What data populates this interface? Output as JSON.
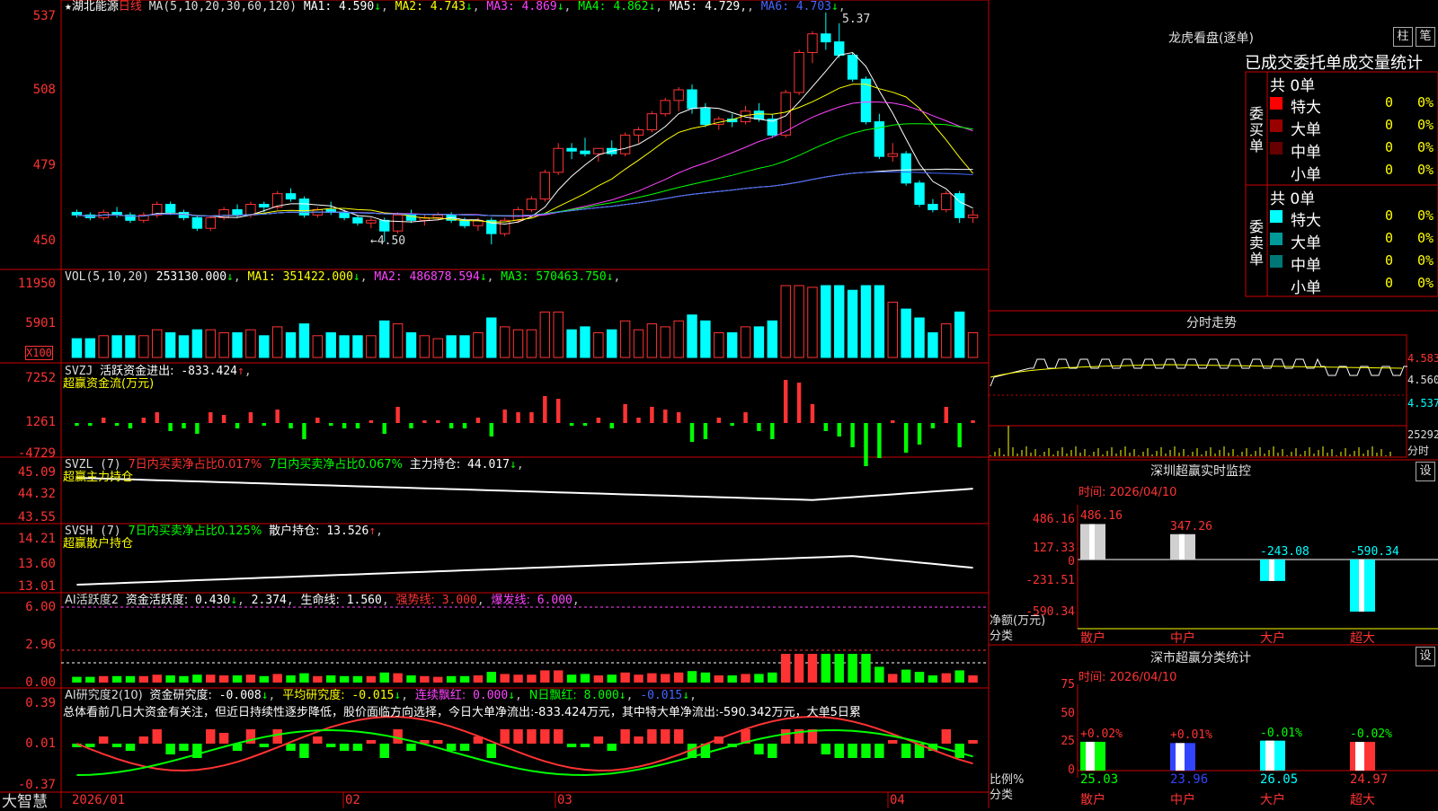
{
  "app": {
    "stock_name": "湖北能源",
    "period": "日线",
    "brand": "大智慧",
    "favorite_marker": "★"
  },
  "colors": {
    "up": "#ff3333",
    "down": "#00ffff",
    "ma1": "#ffffff",
    "ma2": "#ffff00",
    "ma3": "#ff44ff",
    "ma4": "#00ff00",
    "ma5": "#ffffff",
    "ma6": "#4466ff",
    "grid": "#cc0000"
  },
  "price_panel": {
    "ma_params": "MA(5,10,20,30,60,120)",
    "ma": [
      {
        "label": "MA1:",
        "value": "4.590",
        "arrow": "↓"
      },
      {
        "label": "MA2:",
        "value": "4.743",
        "arrow": "↓"
      },
      {
        "label": "MA3:",
        "value": "4.869",
        "arrow": "↓"
      },
      {
        "label": "MA4:",
        "value": "4.862",
        "arrow": "↓"
      },
      {
        "label": "MA5:",
        "value": "4.729",
        "arrow": ","
      },
      {
        "label": "MA6:",
        "value": "4.703",
        "arrow": "↓"
      }
    ],
    "yticks": [
      "537",
      "508",
      "479",
      "450"
    ],
    "high_label": "5.37",
    "low_label": "4.50"
  },
  "vol_panel": {
    "header": "VOL(5,10,20)",
    "value": "253130.000",
    "ma": [
      {
        "label": "MA1:",
        "value": "351422.000",
        "arrow": "↓"
      },
      {
        "label": "MA2:",
        "value": "486878.594",
        "arrow": "↓"
      },
      {
        "label": "MA3:",
        "value": "570463.750",
        "arrow": "↓"
      }
    ],
    "yticks": [
      "11950",
      "5901"
    ],
    "unit": "X100"
  },
  "svzj_panel": {
    "code": "SVZJ",
    "label": "活跃资金进出:",
    "value": "-833.424",
    "arrow": "↑",
    "subtitle": "超赢资金流(万元)",
    "yticks": [
      "7252",
      "1261",
      "-4729"
    ]
  },
  "svzl_panel": {
    "code": "SVZL (7)",
    "label_a": "7日内买卖净占比0.017%",
    "label_b": "7日内买卖净占比0.067%",
    "label_c": "主力持仓:",
    "value": "44.017",
    "arrow": "↓",
    "subtitle": "超赢主力持仓",
    "yticks": [
      "45.09",
      "44.32",
      "43.55"
    ]
  },
  "svsh_panel": {
    "code": "SVSH (7)",
    "label_a": "7日内买卖净占比0.125%",
    "label_c": "散户持仓:",
    "value": "13.526",
    "arrow": "↑",
    "subtitle": "超赢散户持仓",
    "yticks": [
      "14.21",
      "13.60",
      "13.01"
    ]
  },
  "ai_active_panel": {
    "code": "AI活跃度2",
    "label": "资金活跃度:",
    "value": "0.430",
    "arrow": "↓",
    "value2": "2.374",
    "life_label": "生命线:",
    "life_value": "1.560",
    "strong_label": "强势线:",
    "strong_value": "3.000",
    "burst_label": "爆发线:",
    "burst_value": "6.000",
    "yticks": [
      "6.00",
      "2.96",
      "0.00"
    ]
  },
  "ai_research_panel": {
    "code": "AI研究度2(10)",
    "label": "资金研究度:",
    "value": "-0.008",
    "avg_label": "平均研究度:",
    "avg_value": "-0.015",
    "red_label": "连续飘红:",
    "red_value": "0.000",
    "nred_label": "N日飘红:",
    "nred_value": "8.000",
    "extra_value": "-0.015",
    "comment": "总体看前几日大资金有关注，但近日持续性逐步降低，股价面临方向选择，今日大单净流出:-833.424万元，其中特大单净流出:-590.342万元，大单5日累",
    "yticks": [
      "0.39",
      "0.01",
      "-0.37"
    ]
  },
  "x_axis": [
    "2026/01",
    "02",
    "03",
    "04"
  ],
  "right": {
    "lhb_title": "龙虎看盘(逐单)",
    "tab_bar": "柱",
    "tab_pen": "笔",
    "table_title": "已成交委托单成交量统计",
    "buy": {
      "side_label": "委买单",
      "total": "共 0单",
      "rows": [
        {
          "name": "特大",
          "count": "0",
          "pct": "0%",
          "color": "#ff0000"
        },
        {
          "name": "大单",
          "count": "0",
          "pct": "0%",
          "color": "#990000"
        },
        {
          "name": "中单",
          "count": "0",
          "pct": "0%",
          "color": "#660000"
        },
        {
          "name": "小单",
          "count": "0",
          "pct": "0%",
          "color": "#000000"
        }
      ]
    },
    "sell": {
      "side_label": "委卖单",
      "total": "共 0单",
      "rows": [
        {
          "name": "特大",
          "count": "0",
          "pct": "0%",
          "color": "#00ffff"
        },
        {
          "name": "大单",
          "count": "0",
          "pct": "0%",
          "color": "#009999"
        },
        {
          "name": "中单",
          "count": "0",
          "pct": "0%",
          "color": "#007777"
        },
        {
          "name": "小单",
          "count": "0",
          "pct": "0%",
          "color": "#000000"
        }
      ]
    },
    "intraday_title": "分时走势",
    "intraday_yticks": [
      "4.583",
      "4.560",
      "4.537"
    ],
    "intraday_vol": "25292",
    "intraday_vol_label": "分时",
    "sz_title": "深圳超赢实时监控",
    "sz_time": "时间: 2026/04/10",
    "sz_yticks": [
      "486.16",
      "127.33",
      "0",
      "-231.51",
      "-590.34"
    ],
    "sz_ylabel": "净额(万元)",
    "sz_xlabel": "分类",
    "sz_bars": [
      {
        "cat": "散户",
        "label": "486.16",
        "value": 486.16
      },
      {
        "cat": "中户",
        "label": "347.26",
        "value": 347.26
      },
      {
        "cat": "大户",
        "label": "-243.08",
        "value": -243.08
      },
      {
        "cat": "超大",
        "label": "-590.34",
        "value": -590.34
      }
    ],
    "ss_title": "深市超赢分类统计",
    "ss_time": "时间: 2026/04/10",
    "ss_yticks": [
      "75",
      "50",
      "25",
      "0"
    ],
    "ss_ylabel": "比例%",
    "ss_xlabel": "分类",
    "ss_bars": [
      {
        "cat": "散户",
        "change": "+0.02%",
        "value": 25.03,
        "label": "25.03",
        "color": "#00ff00"
      },
      {
        "cat": "中户",
        "change": "+0.01%",
        "value": 23.96,
        "label": "23.96",
        "color": "#3344ff"
      },
      {
        "cat": "大户",
        "change": "-0.01%",
        "value": 26.05,
        "label": "26.05",
        "color": "#00ffff"
      },
      {
        "cat": "超大",
        "change": "-0.02%",
        "value": 24.97,
        "label": "24.97",
        "color": "#ff3333"
      }
    ],
    "settings_btn": "设"
  },
  "chart_data": {
    "type": "candlestick",
    "ohlc": [
      [
        4.62,
        4.63,
        4.6,
        4.61
      ],
      [
        4.61,
        4.62,
        4.59,
        4.6
      ],
      [
        4.6,
        4.63,
        4.59,
        4.62
      ],
      [
        4.62,
        4.64,
        4.6,
        4.61
      ],
      [
        4.61,
        4.62,
        4.58,
        4.59
      ],
      [
        4.59,
        4.62,
        4.58,
        4.61
      ],
      [
        4.61,
        4.66,
        4.6,
        4.65
      ],
      [
        4.65,
        4.66,
        4.61,
        4.62
      ],
      [
        4.62,
        4.63,
        4.59,
        4.6
      ],
      [
        4.6,
        4.61,
        4.55,
        4.56
      ],
      [
        4.56,
        4.61,
        4.55,
        4.6
      ],
      [
        4.6,
        4.64,
        4.59,
        4.63
      ],
      [
        4.63,
        4.65,
        4.6,
        4.61
      ],
      [
        4.61,
        4.66,
        4.6,
        4.65
      ],
      [
        4.65,
        4.66,
        4.62,
        4.64
      ],
      [
        4.64,
        4.7,
        4.63,
        4.69
      ],
      [
        4.69,
        4.71,
        4.66,
        4.67
      ],
      [
        4.67,
        4.68,
        4.6,
        4.61
      ],
      [
        4.61,
        4.64,
        4.6,
        4.63
      ],
      [
        4.63,
        4.66,
        4.61,
        4.62
      ],
      [
        4.62,
        4.63,
        4.59,
        4.6
      ],
      [
        4.6,
        4.61,
        4.57,
        4.58
      ],
      [
        4.58,
        4.6,
        4.56,
        4.59
      ],
      [
        4.59,
        4.6,
        4.51,
        4.55
      ],
      [
        4.55,
        4.62,
        4.54,
        4.61
      ],
      [
        4.61,
        4.63,
        4.58,
        4.59
      ],
      [
        4.59,
        4.61,
        4.57,
        4.6
      ],
      [
        4.6,
        4.62,
        4.59,
        4.61
      ],
      [
        4.61,
        4.62,
        4.58,
        4.59
      ],
      [
        4.59,
        4.6,
        4.56,
        4.57
      ],
      [
        4.57,
        4.6,
        4.55,
        4.59
      ],
      [
        4.59,
        4.6,
        4.5,
        4.54
      ],
      [
        4.54,
        4.6,
        4.53,
        4.59
      ],
      [
        4.59,
        4.64,
        4.58,
        4.63
      ],
      [
        4.63,
        4.68,
        4.62,
        4.67
      ],
      [
        4.67,
        4.78,
        4.66,
        4.77
      ],
      [
        4.77,
        4.88,
        4.76,
        4.86
      ],
      [
        4.86,
        4.88,
        4.82,
        4.85
      ],
      [
        4.85,
        4.9,
        4.83,
        4.84
      ],
      [
        4.84,
        4.86,
        4.81,
        4.86
      ],
      [
        4.86,
        4.89,
        4.83,
        4.84
      ],
      [
        4.84,
        4.92,
        4.83,
        4.91
      ],
      [
        4.91,
        4.94,
        4.88,
        4.93
      ],
      [
        4.93,
        5.0,
        4.92,
        4.99
      ],
      [
        4.99,
        5.05,
        4.98,
        5.04
      ],
      [
        5.04,
        5.09,
        5.0,
        5.08
      ],
      [
        5.08,
        5.1,
        4.99,
        5.01
      ],
      [
        5.01,
        5.03,
        4.94,
        4.95
      ],
      [
        4.95,
        4.98,
        4.93,
        4.97
      ],
      [
        4.97,
        4.99,
        4.94,
        4.96
      ],
      [
        4.96,
        5.02,
        4.95,
        5.0
      ],
      [
        5.0,
        5.03,
        4.96,
        4.97
      ],
      [
        4.97,
        4.99,
        4.9,
        4.91
      ],
      [
        4.91,
        5.08,
        4.9,
        5.07
      ],
      [
        5.07,
        5.23,
        5.06,
        5.22
      ],
      [
        5.22,
        5.3,
        5.18,
        5.29
      ],
      [
        5.29,
        5.37,
        5.23,
        5.26
      ],
      [
        5.26,
        5.33,
        5.2,
        5.21
      ],
      [
        5.21,
        5.22,
        5.11,
        5.12
      ],
      [
        5.12,
        5.13,
        4.95,
        4.96
      ],
      [
        4.96,
        4.99,
        4.82,
        4.83
      ],
      [
        4.83,
        4.88,
        4.81,
        4.84
      ],
      [
        4.84,
        4.85,
        4.72,
        4.73
      ],
      [
        4.73,
        4.74,
        4.64,
        4.65
      ],
      [
        4.65,
        4.67,
        4.62,
        4.63
      ],
      [
        4.63,
        4.7,
        4.62,
        4.69
      ],
      [
        4.69,
        4.7,
        4.58,
        4.6
      ],
      [
        4.6,
        4.63,
        4.58,
        4.61
      ]
    ],
    "ylim": [
      4.5,
      5.37
    ]
  }
}
